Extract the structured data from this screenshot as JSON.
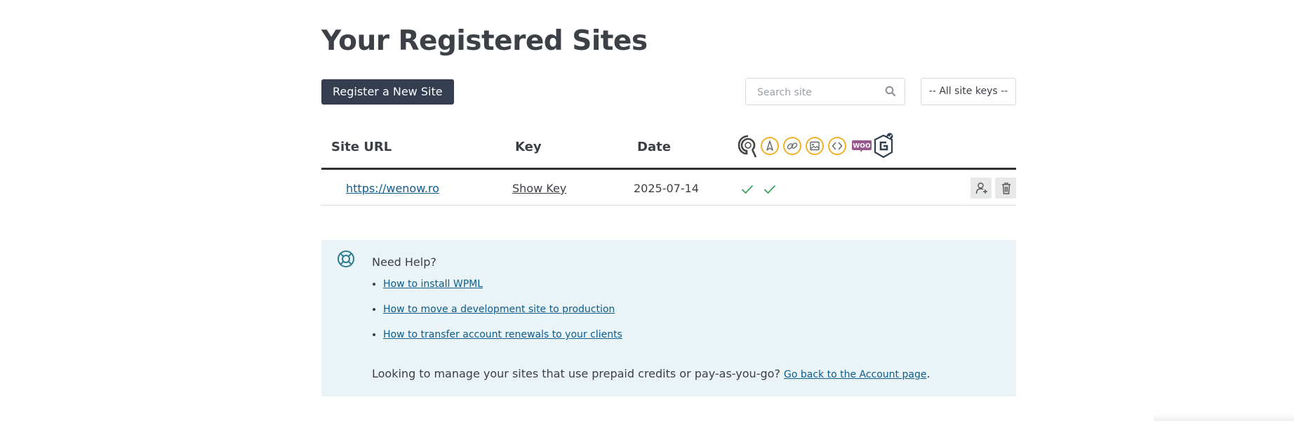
{
  "page": {
    "title": "Your Registered Sites"
  },
  "toolbar": {
    "register_label": "Register a New Site",
    "search_placeholder": "Search site",
    "site_keys_filter": "-- All site keys --"
  },
  "table": {
    "headers": {
      "site_url": "Site URL",
      "key": "Key",
      "date": "Date"
    },
    "header_icons": [
      "support-icon",
      "compass-icon",
      "link-icon",
      "image-icon",
      "code-icon",
      "woo-icon",
      "plugin-badge-icon"
    ],
    "woo_text": "WOO",
    "rows": [
      {
        "url": "https://wenow.ro",
        "key_label": "Show Key",
        "date": "2025-07-14",
        "checks": 2
      }
    ]
  },
  "help": {
    "title": "Need Help?",
    "links": [
      "How to install WPML",
      "How to move a development site to production",
      "How to transfer account renewals to your clients"
    ],
    "bottom_text": "Looking to manage your sites that use prepaid credits or pay-as-you-go?",
    "bottom_link": "Go back to the Account page",
    "bottom_end": "."
  },
  "colors": {
    "primary_button": "#343e50",
    "link": "#0b5c8f",
    "help_bg": "#eaf3f5",
    "icon_gold": "#f2a915",
    "woo_purple": "#96588a",
    "check_green": "#3c9e5f"
  }
}
